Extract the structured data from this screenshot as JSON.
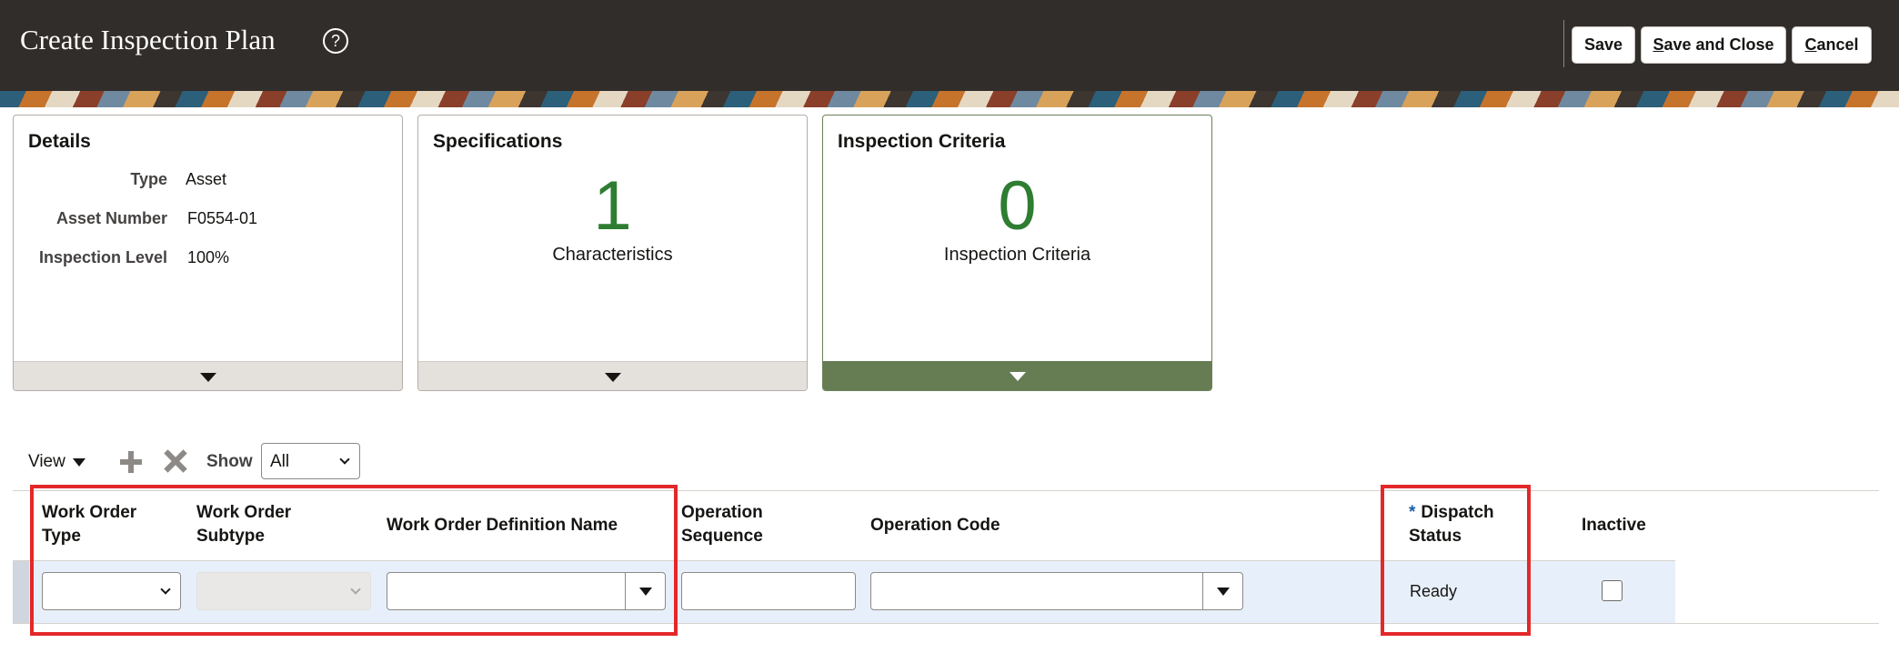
{
  "header": {
    "title": "Create Inspection Plan",
    "help_glyph": "?",
    "buttons": {
      "save": "Save",
      "save_and_close": "Save and Close",
      "cancel_first": "C",
      "cancel_rest": "ancel",
      "save_and_close_first": "S",
      "save_and_close_rest": "ave and Close"
    }
  },
  "cards": {
    "details": {
      "title": "Details",
      "fields": [
        {
          "label": "Type",
          "value": "Asset"
        },
        {
          "label": "Asset Number",
          "value": "F0554-01"
        },
        {
          "label": "Inspection Level",
          "value": "100%"
        }
      ]
    },
    "specifications": {
      "title": "Specifications",
      "count": "1",
      "caption": "Characteristics"
    },
    "inspection_criteria": {
      "title": "Inspection Criteria",
      "count": "0",
      "caption": "Inspection Criteria"
    }
  },
  "toolbar": {
    "view_label": "View",
    "show_label": "Show",
    "show_value": "All"
  },
  "table": {
    "columns": {
      "work_order_type_line1": "Work Order",
      "work_order_type_line2": "Type",
      "work_order_subtype_line1": "Work Order",
      "work_order_subtype_line2": "Subtype",
      "work_order_definition_name": "Work Order Definition Name",
      "operation_sequence_line1": "Operation",
      "operation_sequence_line2": "Sequence",
      "operation_code": "Operation Code",
      "dispatch_status_required": "*",
      "dispatch_status_line1": "Dispatch",
      "dispatch_status_line2": "Status",
      "inactive": "Inactive"
    },
    "row": {
      "work_order_type": "",
      "work_order_subtype": "",
      "work_order_definition_name": "",
      "operation_sequence": "",
      "operation_code": "",
      "dispatch_status": "Ready",
      "inactive": false
    }
  },
  "colors": {
    "header_bg": "#312d2a",
    "count_green": "#2e7d32",
    "active_card_footer": "#667d54",
    "highlight_red": "#e3282a",
    "row_bg": "#e7f0fa"
  }
}
